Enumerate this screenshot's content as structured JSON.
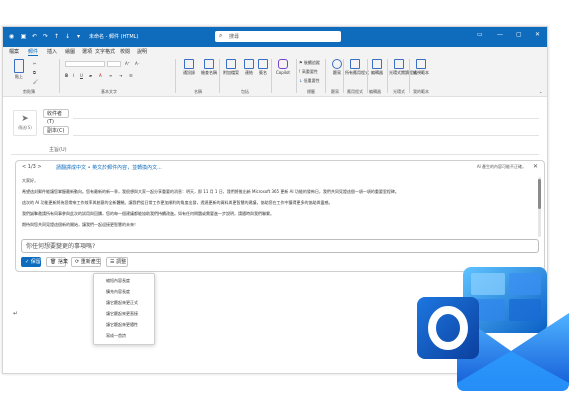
{
  "titlebar": {
    "title": "未命名 - 郵件 (HTML)",
    "search_placeholder": "搜尋"
  },
  "menu": {
    "items": [
      "檔案",
      "郵件",
      "插入",
      "繪圖",
      "選項",
      "文字格式",
      "校閱",
      "說明"
    ],
    "active_index": 1
  },
  "ribbon": {
    "groups": [
      "剪貼簿",
      "基本文字",
      "名稱",
      "包括",
      "標籤",
      "聽寫",
      "語音",
      "應用程式",
      "編輯器",
      "光環式",
      "我的範本"
    ],
    "buttons": {
      "paste": "貼上",
      "address_book": "通訊錄",
      "check_names": "檢查名稱",
      "attach": "附加檔案",
      "link": "連結",
      "signature": "簽名",
      "copilot": "Copilot",
      "follow_up": "後續追蹤",
      "high_importance": "高重要性",
      "low_importance": "低重要性",
      "dictate": "聽寫",
      "read_aloud": "朗讀",
      "apps": "所有應用程式",
      "editor": "編輯器",
      "immersive": "光環式閱讀程式",
      "templates": "檢視範本"
    }
  },
  "compose": {
    "send_label": "傳送(S)",
    "to_label": "收件者(T)",
    "cc_label": "副本(C)",
    "subject_label": "主旨(U)"
  },
  "copilot": {
    "nav": "< 1/3 >",
    "link_text": "請翻譯成中文 • 英文於郵件內容，並轉換內文...",
    "warning": "AI 產生的內容可能不正確。",
    "paragraphs": [
      "大家好，",
      "希望這封郵件能讓您掌握最新動向。您有最新的新一季，我很想與大家一起分享重要的消息：明天，即 11 月 1 日，我們將推出新 Microsoft 365 更新 AI 功能的發佈日，我們共同見證這個一項一項的重要里程碑。",
      "這次的 AI 功能更新將為您帶來工作效率與創意的全新體驗。讓我們從日常工作更加順利的角度出發，透過更新的資料與更智慧的建議，協助您在工作中獲得更多的協助與靈感。",
      "我們誠摯邀請所有同事參與此次的試用與回饋，您的每一個建議都能協助我們持續改進。如有任何問題或需要進一步說明，請隨時與我們聯繫。",
      "期待與您共同見證這個新的開始，讓我們一起迎接更智慧的未來！"
    ],
    "prompt_placeholder": "你任何想要變更的事項嗎?",
    "actions": [
      "保留",
      "捨棄",
      "重新產生",
      "調整"
    ]
  },
  "adjust_menu": {
    "items": [
      "縮短內容長度",
      "擴充內容長度",
      "讓它聽起來更正式",
      "讓它聽起來更直接",
      "讓它聽起來更隨性",
      "寫成一首詩"
    ]
  },
  "colors": {
    "accent": "#0f6cbd",
    "titlebar": "#0f6cbd",
    "ribbon": "#f3f3f3"
  }
}
